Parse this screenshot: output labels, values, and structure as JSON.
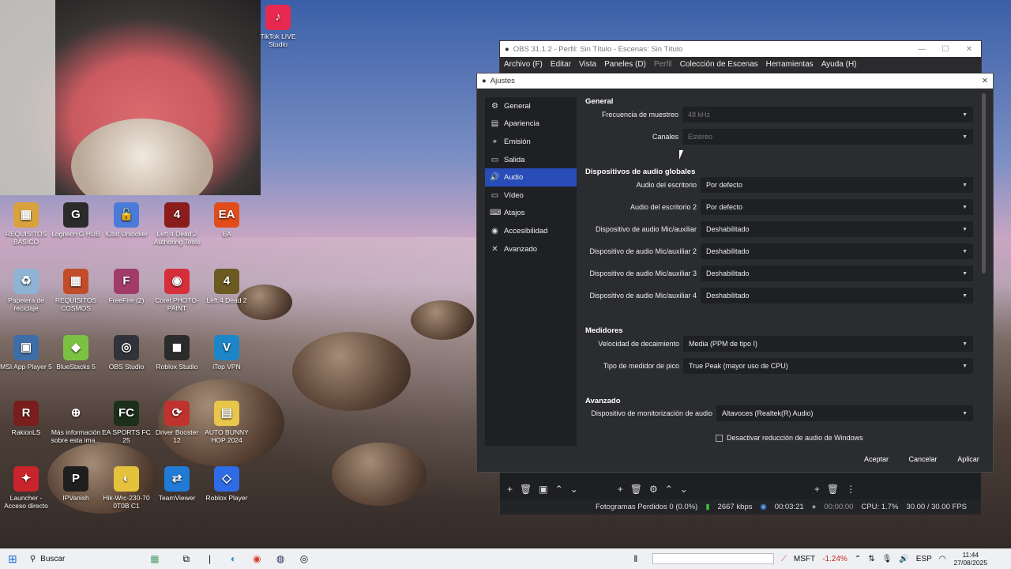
{
  "desktop": {
    "icons": [
      {
        "label": "TikTok LIVE Studio",
        "glyph": "♪",
        "bg": "#e8294f"
      },
      {
        "label": "REQUISITOS BASICO",
        "glyph": "▦",
        "bg": "#d9a23d"
      },
      {
        "label": "Logitech G HUB",
        "glyph": "G",
        "bg": "#2b2b2b"
      },
      {
        "label": "IObit Unlocker",
        "glyph": "🔓",
        "bg": "#4b7bd8"
      },
      {
        "label": "Left 4 Dead 2 Authoring Tools",
        "glyph": "4",
        "bg": "#8a1c1c"
      },
      {
        "label": "EA",
        "glyph": "EA",
        "bg": "#e24c1b"
      },
      {
        "label": "Papelera de reciclaje",
        "glyph": "♻",
        "bg": "#8fb3d4"
      },
      {
        "label": "REQUISITOS COSMOS",
        "glyph": "▦",
        "bg": "#c24b2a"
      },
      {
        "label": "FreeFire (2)",
        "glyph": "F",
        "bg": "#a13b6a"
      },
      {
        "label": "Corel PHOTO-PAINT",
        "glyph": "◉",
        "bg": "#d62f3b"
      },
      {
        "label": "Left 4 Dead 2",
        "glyph": "4",
        "bg": "#6b5a21"
      },
      {
        "label": "MSI App Player 5",
        "glyph": "▣",
        "bg": "#3e6ea8"
      },
      {
        "label": "BlueStacks 5",
        "glyph": "◆",
        "bg": "#7cc242"
      },
      {
        "label": "OBS Studio",
        "glyph": "◎",
        "bg": "#30333a"
      },
      {
        "label": "Roblox Studio",
        "glyph": "◼",
        "bg": "#2b2b2b"
      },
      {
        "label": "iTop VPN",
        "glyph": "V",
        "bg": "#1c86c9"
      },
      {
        "label": "RakionLS",
        "glyph": "R",
        "bg": "#7a1d1d"
      },
      {
        "label": "Más información sobre esta ima...",
        "glyph": "⊕",
        "bg": "transparent"
      },
      {
        "label": "EA SPORTS FC 25",
        "glyph": "FC",
        "bg": "#1b2f1b"
      },
      {
        "label": "Driver Booster 12",
        "glyph": "⟳",
        "bg": "#c0322d"
      },
      {
        "label": "AUTO BUNNY HOP 2024",
        "glyph": "▤",
        "bg": "#e8c64b"
      },
      {
        "label": "Launcher - Acceso directo",
        "glyph": "✦",
        "bg": "#c9242c"
      },
      {
        "label": "IPVanish",
        "glyph": "P",
        "bg": "#1e1e1e"
      },
      {
        "label": "Hik-Wrc-230-70 0T0B C1",
        "glyph": "◐",
        "bg": "#e5c23b"
      },
      {
        "label": "TeamViewer",
        "glyph": "⇄",
        "bg": "#1f7bd6"
      },
      {
        "label": "Roblox Player",
        "glyph": "◇",
        "bg": "#2e6be6"
      }
    ]
  },
  "obs": {
    "title": "OBS 31.1.2 - Perfil: Sin Título - Escenas: Sin Título",
    "window_controls": [
      "—",
      "☐",
      "✕"
    ],
    "menu": [
      "Archivo (F)",
      "Editar",
      "Vista",
      "Paneles (D)",
      "Perfil",
      "Colección de Escenas",
      "Herramientas",
      "Ayuda (H)"
    ],
    "status": {
      "dropped": "Fotogramas Perdidos 0 (0.0%)",
      "bitrate": "2667 kbps",
      "rec_time": "00:03:21",
      "stream_time": "00:00:00",
      "cpu": "CPU: 1.7%",
      "fps": "30.00 / 30.00 FPS"
    }
  },
  "dialog": {
    "title": "Ajustes",
    "nav": [
      {
        "label": "General",
        "icon": "⚙"
      },
      {
        "label": "Apariencia",
        "icon": "▤"
      },
      {
        "label": "Emisión",
        "icon": "⌖"
      },
      {
        "label": "Salida",
        "icon": "▭"
      },
      {
        "label": "Audio",
        "icon": "🔊"
      },
      {
        "label": "Vídeo",
        "icon": "▭"
      },
      {
        "label": "Atajos",
        "icon": "⌨"
      },
      {
        "label": "Accesibilidad",
        "icon": "◉"
      },
      {
        "label": "Avanzado",
        "icon": "✕"
      }
    ],
    "active_nav": "Audio",
    "sections": {
      "general": "General",
      "global_devices": "Dispositivos de audio globales",
      "meters": "Medidores",
      "advanced": "Avanzado"
    },
    "general_rows": [
      {
        "label": "Frecuencia de muestreo",
        "value": "48 kHz"
      },
      {
        "label": "Canales",
        "value": "Estéreo"
      }
    ],
    "device_rows": [
      {
        "label": "Audio del escritorio",
        "value": "Por defecto"
      },
      {
        "label": "Audio del escritorio 2",
        "value": "Por defecto"
      },
      {
        "label": "Dispositivo de audio Mic/auxiliar",
        "value": "Deshabilitado"
      },
      {
        "label": "Dispositivo de audio Mic/auxiliar 2",
        "value": "Deshabilitado"
      },
      {
        "label": "Dispositivo de audio Mic/auxiliar 3",
        "value": "Deshabilitado"
      },
      {
        "label": "Dispositivo de audio Mic/auxiliar 4",
        "value": "Deshabilitado"
      }
    ],
    "meter_rows": [
      {
        "label": "Velocidad de decaimiento",
        "value": "Media (PPM de tipo I)"
      },
      {
        "label": "Tipo de medidor de pico",
        "value": "True Peak (mayor uso de CPU)"
      }
    ],
    "advanced_rows": [
      {
        "label": "Dispositivo de monitorización de audio",
        "value": "Altavoces (Realtek(R) Audio)"
      }
    ],
    "checkbox": "Desactivar reducción de audio de Windows",
    "buttons": {
      "accept": "Aceptar",
      "cancel": "Cancelar",
      "apply": "Aplicar"
    }
  },
  "taskbar": {
    "search": "Buscar",
    "ticker": "MSFT",
    "ticker_change": "-1.24%",
    "lang": "ESP",
    "time": "11:44",
    "date": "27/08/2025"
  }
}
